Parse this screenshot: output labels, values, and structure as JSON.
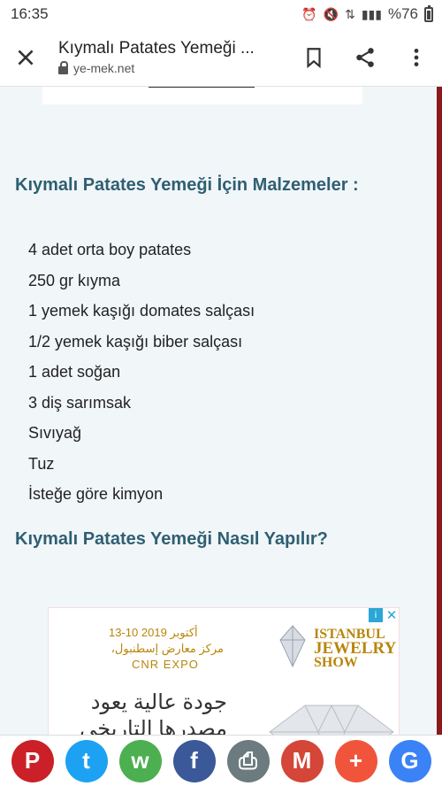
{
  "status_bar": {
    "time": "16:35",
    "battery": "%76"
  },
  "toolbar": {
    "title": "Kıymalı Patates Yemeği ...",
    "host": "ye-mek.net"
  },
  "article": {
    "ingredients_heading": "Kıymalı Patates Yemeği İçin Malzemeler :",
    "ingredients": [
      "4 adet orta boy patates",
      "250 gr kıyma",
      "1 yemek kaşığı domates salçası",
      "1/2 yemek kaşığı biber salçası",
      "1 adet soğan",
      "3 diş sarımsak",
      "Sıvıyağ",
      "Tuz",
      "İsteğe göre kimyon"
    ],
    "method_heading": "Kıymalı Patates Yemeği Nasıl Yapılır?"
  },
  "ad": {
    "date": "13-10 أكتوبر 2019",
    "venue": "،مركز معارض إسطنبول",
    "expo": "CNR EXPO",
    "brand_line1": "ISTANBUL",
    "brand_line2": "JEWELRY",
    "brand_line3": "SHOW",
    "arabic_line1": "جودة عالية يعود",
    "arabic_line2": "مصدرها التاريخي",
    "info_glyph": "i",
    "close_glyph": "✕"
  },
  "share": [
    {
      "name": "pinterest",
      "glyph": "P",
      "color": "#cb2027"
    },
    {
      "name": "twitter",
      "glyph": "t",
      "color": "#1da1f2"
    },
    {
      "name": "whatsapp",
      "glyph": "w",
      "color": "#4caf50"
    },
    {
      "name": "facebook",
      "glyph": "f",
      "color": "#3b5998"
    },
    {
      "name": "print",
      "glyph": "⎙",
      "color": "#6b7b7f"
    },
    {
      "name": "gmail",
      "glyph": "M",
      "color": "#d44638"
    },
    {
      "name": "more",
      "glyph": "+",
      "color": "#f0553c"
    },
    {
      "name": "google",
      "glyph": "G",
      "color": "#3b82f6"
    }
  ],
  "colors": {
    "heading": "#2f5f73",
    "accent_edge": "#8b1a1a",
    "page_bg": "#f1f6f8"
  }
}
